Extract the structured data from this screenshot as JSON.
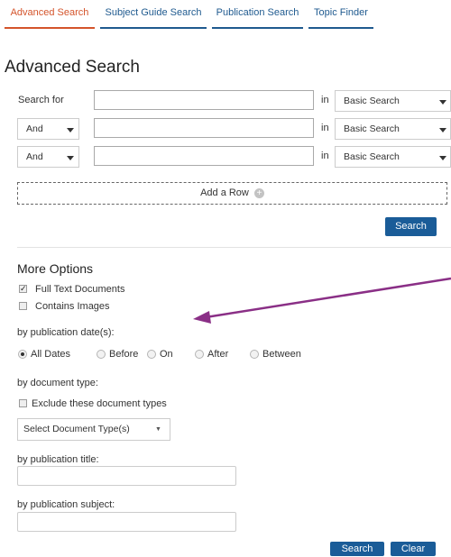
{
  "tabs": [
    "Advanced Search",
    "Subject Guide Search",
    "Publication Search",
    "Topic Finder"
  ],
  "page_title": "Advanced Search",
  "search_rows": [
    {
      "label": "Search for",
      "in_label": "in",
      "field": "Basic Search"
    },
    {
      "operator": "And",
      "in_label": "in",
      "field": "Basic Search"
    },
    {
      "operator": "And",
      "in_label": "in",
      "field": "Basic Search"
    }
  ],
  "add_row_label": "Add a Row",
  "search_button": "Search",
  "more_options": {
    "title": "More Options",
    "checkboxes": [
      {
        "label": "Full Text Documents",
        "checked": true
      },
      {
        "label": "Contains Images",
        "checked": false
      }
    ],
    "pub_date_label": "by publication date(s):",
    "date_options": [
      "All Dates",
      "Before",
      "On",
      "After",
      "Between"
    ],
    "selected_date_option": "All Dates",
    "doc_type_label": "by document type:",
    "exclude_label": "Exclude these document types",
    "doc_type_select": "Select Document Type(s)",
    "pub_title_label": "by publication title:",
    "pub_subject_label": "by publication subject:"
  },
  "bottom_buttons": {
    "search": "Search",
    "clear": "Clear"
  },
  "colors": {
    "active_tab": "#d4542b",
    "tab": "#1f5a8f",
    "button": "#1a5c98",
    "arrow": "#8a2f86"
  }
}
